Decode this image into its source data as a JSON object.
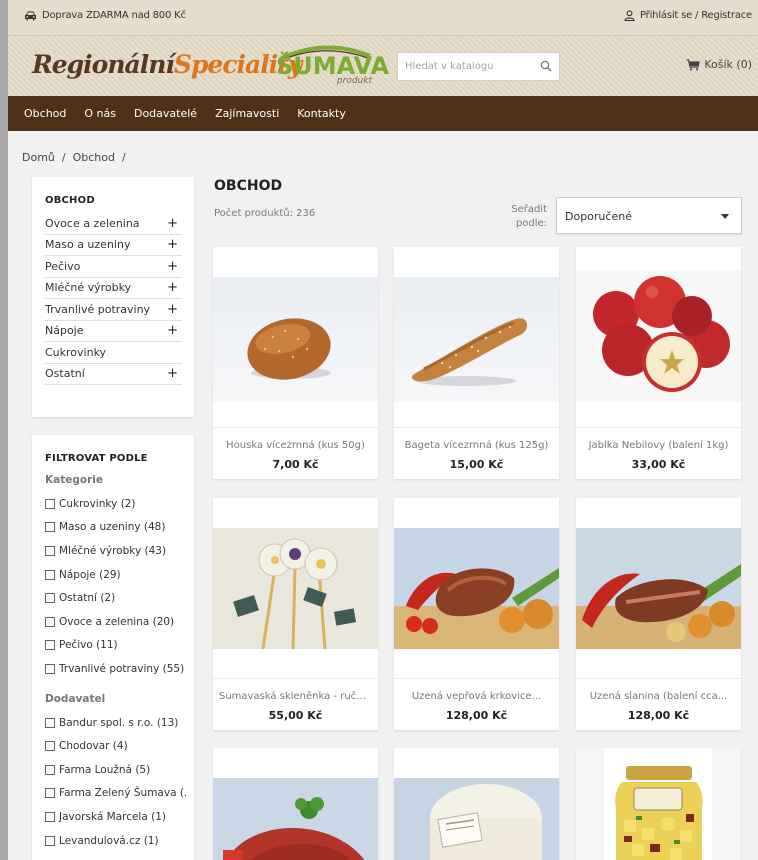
{
  "topbar": {
    "promo": "Doprava ZDARMA nad 800 Kč",
    "login": "Přihlásit se / Registrace"
  },
  "header": {
    "logo_part1": "Regionální",
    "logo_part2": "Speciality",
    "sumava_brand": "ŠUMAVA",
    "sumava_sub": "produkt",
    "search_placeholder": "Hledat v katalogu",
    "cart": "Košík (0)"
  },
  "nav": [
    "Obchod",
    "O nás",
    "Dodavatelé",
    "Zajímavosti",
    "Kontakty"
  ],
  "breadcrumb": "Domů  /  Obchod  /",
  "categories": {
    "title": "OBCHOD",
    "items": [
      {
        "label": "Ovoce a zelenina",
        "plus": "+"
      },
      {
        "label": "Maso a uzeniny",
        "plus": "+"
      },
      {
        "label": "Pečivo",
        "plus": "+"
      },
      {
        "label": "Mléčné výrobky",
        "plus": "+"
      },
      {
        "label": "Trvanlivé potraviny",
        "plus": "+"
      },
      {
        "label": "Nápoje",
        "plus": "+"
      },
      {
        "label": "Cukrovinky",
        "plus": ""
      },
      {
        "label": "Ostatní",
        "plus": "+"
      }
    ]
  },
  "filters": {
    "title": "FILTROVAT PODLE",
    "category_title": "Kategorie",
    "category_items": [
      "Cukrovinky (2)",
      "Maso a uzeniny (48)",
      "Mléčné výrobky (43)",
      "Nápoje (29)",
      "Ostatní (2)",
      "Ovoce a zelenina (20)",
      "Pečivo (11)",
      "Trvanlivé potraviny (55)"
    ],
    "supplier_title": "Dodavatel",
    "supplier_items": [
      "Bandur spol. s r.o. (13)",
      "Chodovar (4)",
      "Farma Loužná (5)",
      "Farma Zelený Šumava (...",
      "Javorská Marcela (1)",
      "Levandulová.cz (1)"
    ]
  },
  "main": {
    "title": "OBCHOD",
    "count": "Počet produktů: 236",
    "sort_label_1": "Seřadit",
    "sort_label_2": "podle:",
    "sort_value": "Doporučené"
  },
  "products": [
    {
      "name": "Houska vícezrnná (kus 50g)",
      "price": "7,00 Kč"
    },
    {
      "name": "Bageta vícezrnná (kus 125g)",
      "price": "15,00 Kč"
    },
    {
      "name": "Jablka Nebilovy (balení 1kg)",
      "price": "33,00 Kč"
    },
    {
      "name": "Šumavaská skleněnka - ručně...",
      "price": "55,00 Kč"
    },
    {
      "name": "Uzená vepřová krkovice...",
      "price": "128,00 Kč"
    },
    {
      "name": "Uzená slanina (balení cca...",
      "price": "128,00 Kč"
    },
    {
      "name": "",
      "price": ""
    },
    {
      "name": "",
      "price": ""
    },
    {
      "name": "",
      "price": ""
    }
  ],
  "colors": {
    "nav_bg": "#4d3219",
    "topbar_bg": "#e4ddcc",
    "logo_brown": "#5a3621",
    "logo_orange": "#e0741c",
    "sumava_green": "#7dab33"
  }
}
